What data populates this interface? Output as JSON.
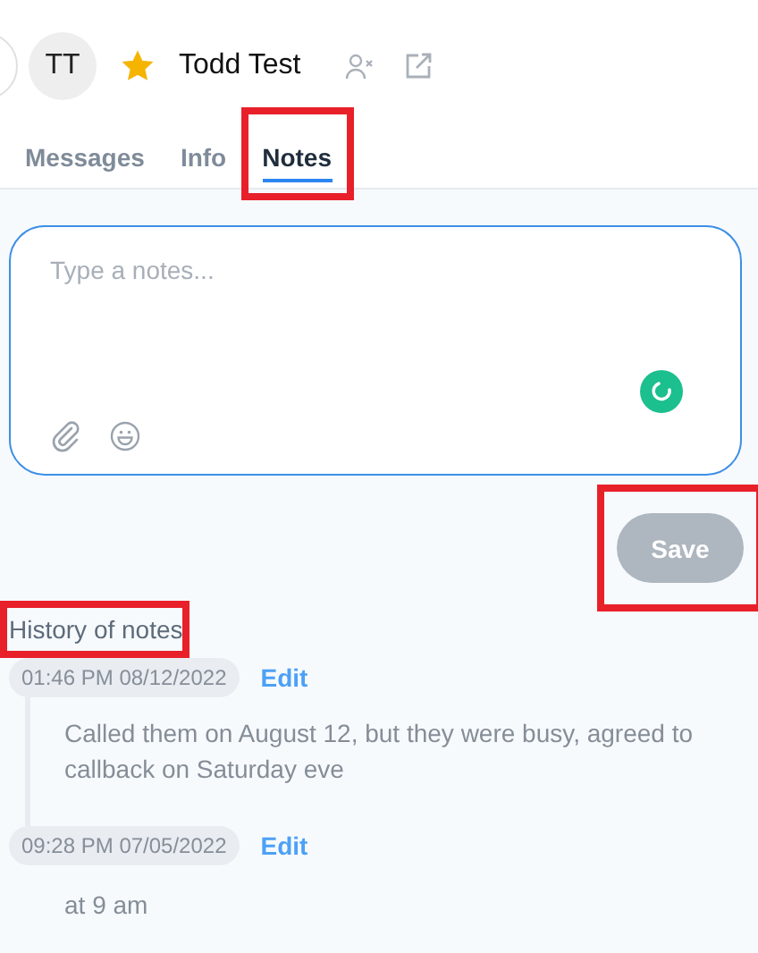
{
  "header": {
    "avatar": "TT",
    "starred": true,
    "name": "Todd Test"
  },
  "tabs": [
    {
      "label": "Messages",
      "selected": false,
      "highlighted": false
    },
    {
      "label": "Info",
      "selected": false,
      "highlighted": false
    },
    {
      "label": "Notes",
      "selected": true,
      "highlighted": true
    }
  ],
  "composer": {
    "placeholder": "Type a notes...",
    "loading": true
  },
  "save_button": {
    "label": "Save",
    "disabled": true,
    "highlighted": true
  },
  "history": {
    "title": "History of notes",
    "highlighted": true,
    "entries": [
      {
        "timestamp": "01:46 PM 08/12/2022",
        "action": "Edit",
        "text": "Called them on August 12, but they were busy, agreed to callback on Saturday eve"
      },
      {
        "timestamp": "09:28 PM 07/05/2022",
        "action": "Edit",
        "text": "at 9 am"
      }
    ]
  }
}
